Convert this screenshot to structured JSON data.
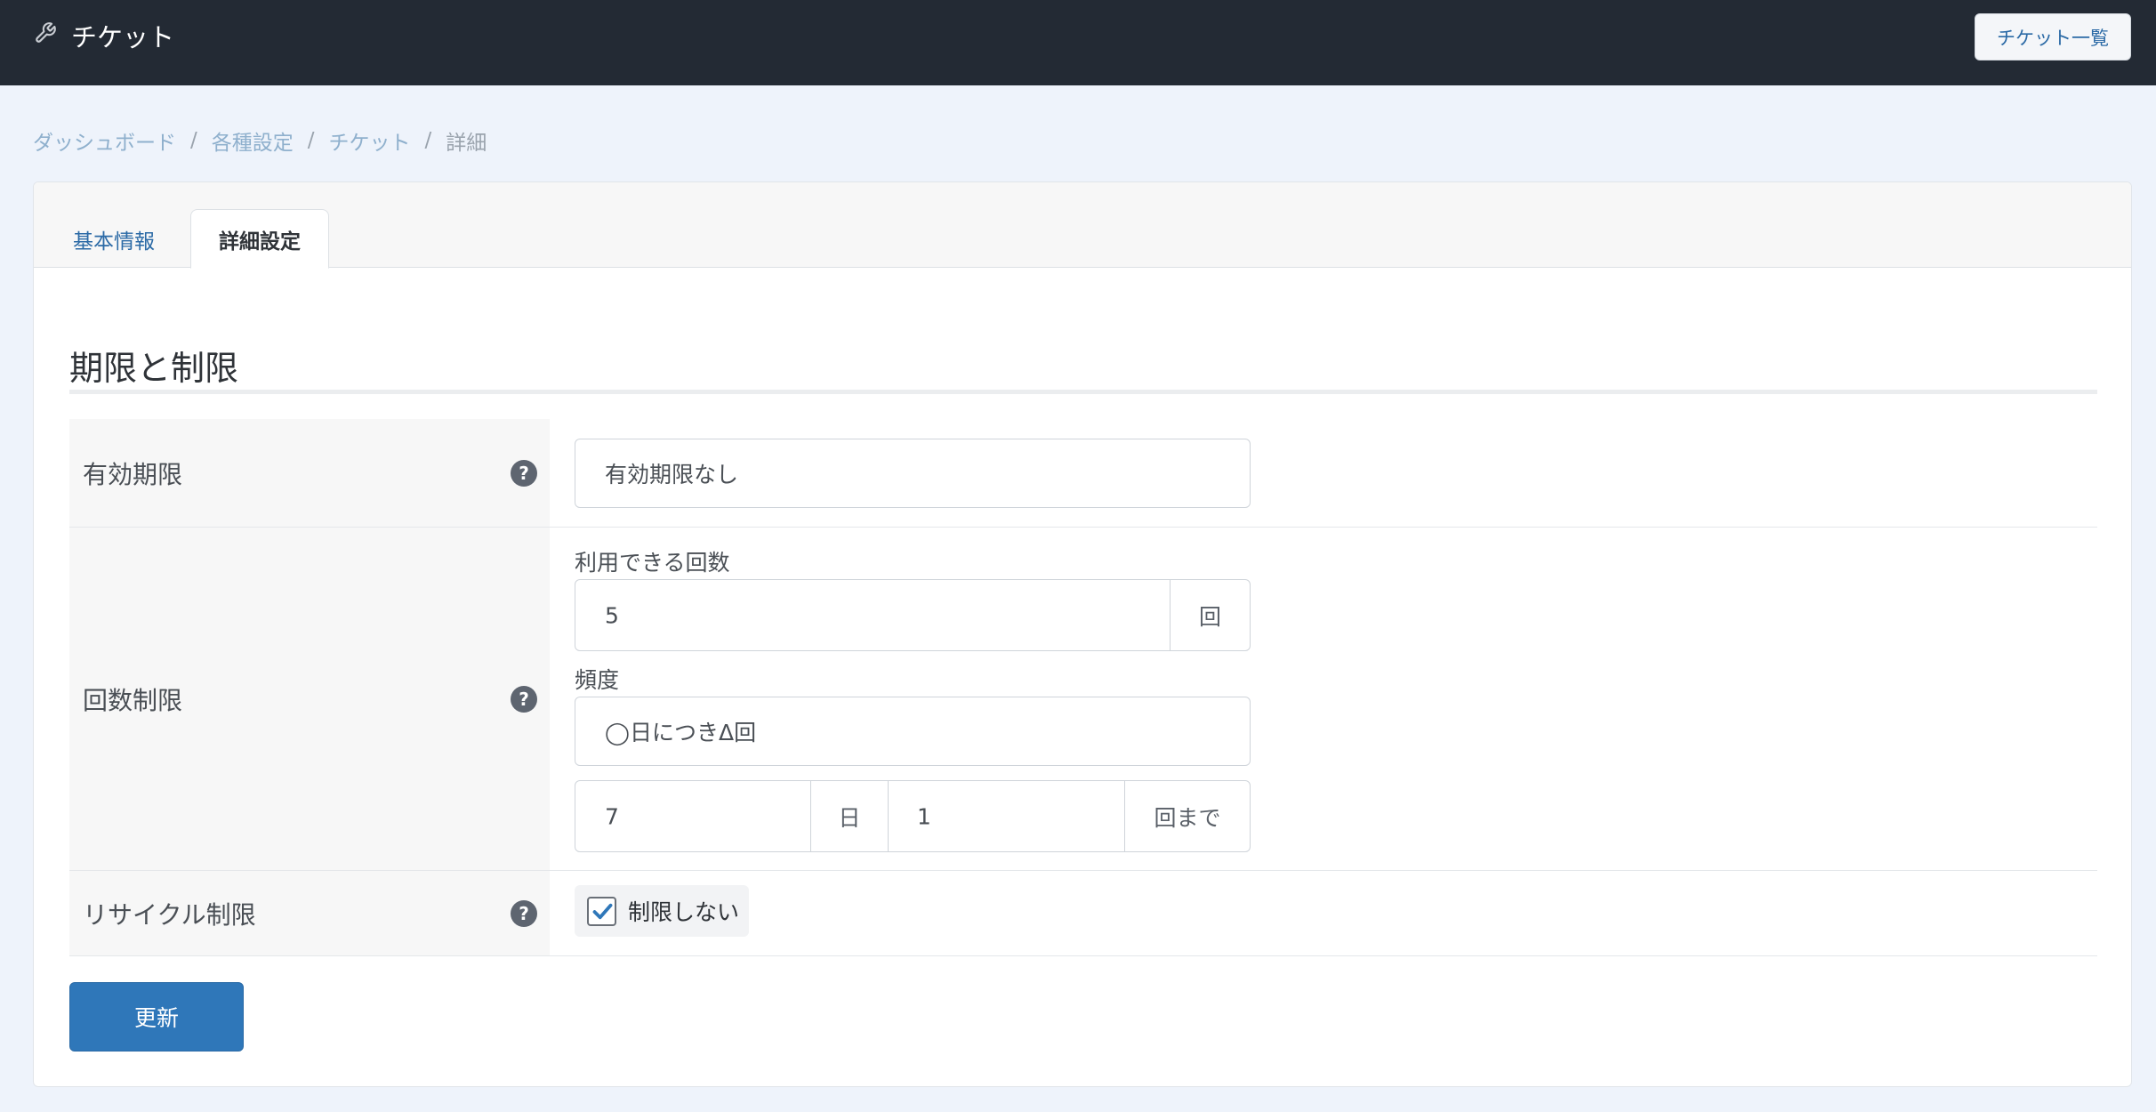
{
  "header": {
    "title": "チケット",
    "title_icon": "wrench-icon",
    "list_button": "チケット一覧"
  },
  "breadcrumb": {
    "items": [
      "ダッシュボード",
      "各種設定",
      "チケット"
    ],
    "separator": "/",
    "current": "詳細"
  },
  "tabs": {
    "basic": "基本情報",
    "detail": "詳細設定",
    "active": "詳細設定"
  },
  "section": {
    "title": "期限と制限"
  },
  "rows": {
    "expiry": {
      "label": "有効期限",
      "value": "有効期限なし"
    },
    "count_limit": {
      "label": "回数制限",
      "uses_label": "利用できる回数",
      "uses_value": "5",
      "uses_unit": "回",
      "frequency_label": "頻度",
      "frequency_value": "◯日につきΔ回",
      "days_value": "7",
      "days_unit": "日",
      "times_value": "1",
      "times_unit": "回まで"
    },
    "recycle": {
      "label": "リサイクル制限",
      "checkbox_label": "制限しない",
      "checked": true
    }
  },
  "help_icon": "?",
  "submit_button": "更新",
  "colors": {
    "topbar": "#232a34",
    "accent": "#2f77b9",
    "link": "#2b6aa6"
  }
}
